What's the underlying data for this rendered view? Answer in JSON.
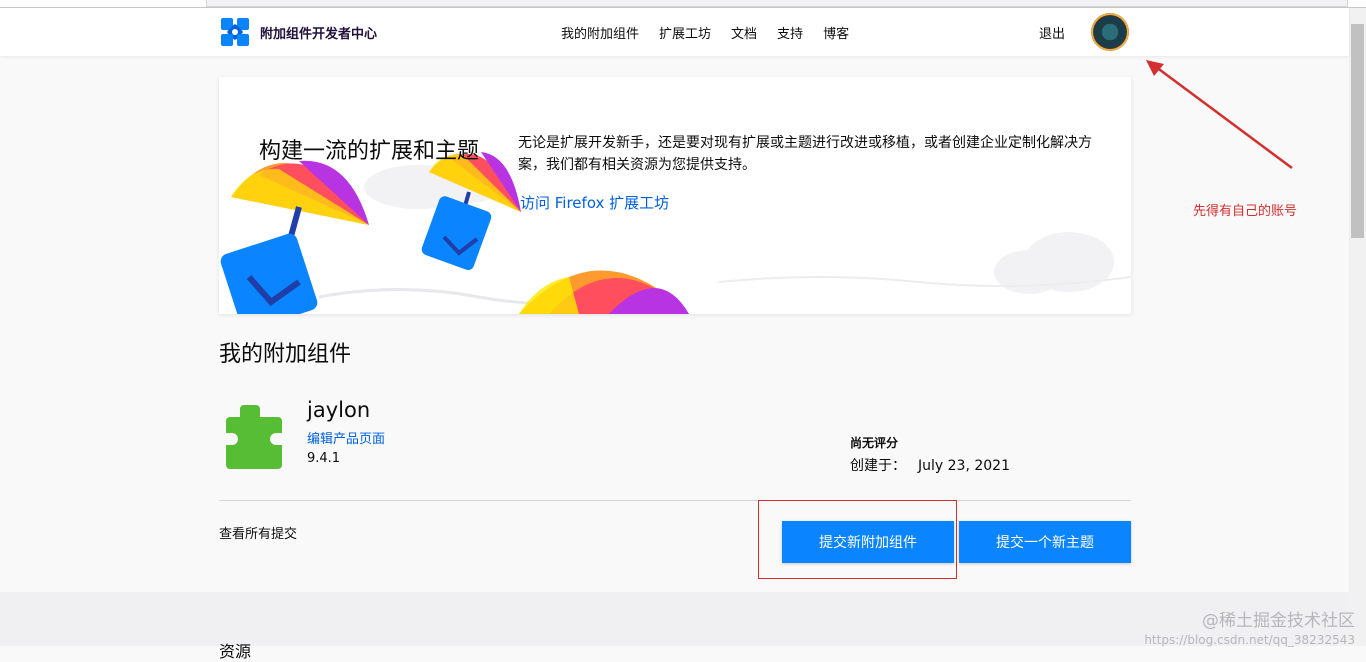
{
  "header": {
    "brand": "附加组件开发者中心",
    "nav": [
      "我的附加组件",
      "扩展工坊",
      "文档",
      "支持",
      "博客"
    ],
    "logout": "退出"
  },
  "hero": {
    "title": "构建一流的扩展和主题",
    "description": "无论是扩展开发新手，还是要对现有扩展或主题进行改进或移植，或者创建企业定制化解决方案，我们都有相关资源为您提供支持。",
    "link": "访问 Firefox 扩展工坊"
  },
  "section_title": "我的附加组件",
  "addon": {
    "name": "jaylon",
    "edit_link": "编辑产品页面",
    "version": "9.4.1",
    "rating": "尚无评分",
    "created_label": "创建于：",
    "created_date": "July 23, 2021",
    "icon": "puzzle-piece-icon",
    "icon_color": "#57bd35"
  },
  "actions": {
    "view_all": "查看所有提交",
    "submit_addon": "提交新附加组件",
    "submit_theme": "提交一个新主题"
  },
  "annotation": {
    "note": "先得有自己的账号",
    "color": "#d32f2f"
  },
  "footer": {
    "section_title": "资源"
  },
  "watermark": {
    "main": "@稀土掘金技术社区",
    "url": "https://blog.csdn.net/qq_38232543"
  },
  "colors": {
    "primary_button": "#0a84ff",
    "link": "#0060df",
    "brand_logo": "#0a84ff"
  }
}
